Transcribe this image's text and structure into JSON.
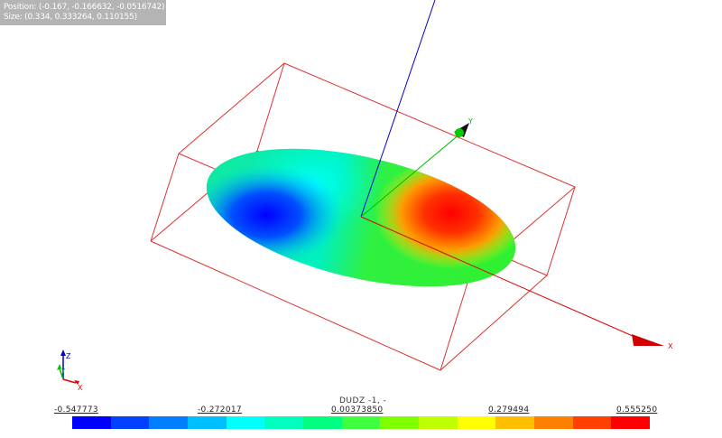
{
  "info": {
    "position": "Position: (-0.167, -0.166632, -0.0516742)",
    "size": "Size: (0.334, 0.333264, 0.110155)"
  },
  "scene": {
    "object": "ellipsoid colored by DUDZ",
    "bounding_box_color": "#e03030",
    "axis_colors": {
      "x": "#e00000",
      "y": "#00c000",
      "z": "#0000cc"
    },
    "axis_labels": {
      "x": "X",
      "y": "Y",
      "z": "Z"
    }
  },
  "legend": {
    "title": "DUDZ -1, -",
    "ticks": [
      "-0.547773",
      "-0.272017",
      "0.00373850",
      "0.279494",
      "0.555250"
    ],
    "colormap": [
      "#0000ff",
      "#0040ff",
      "#0080ff",
      "#00bfff",
      "#00ffff",
      "#00ffbf",
      "#00ff80",
      "#40ff40",
      "#80ff00",
      "#bfff00",
      "#ffff00",
      "#ffbf00",
      "#ff8000",
      "#ff4000",
      "#ff0000"
    ]
  }
}
